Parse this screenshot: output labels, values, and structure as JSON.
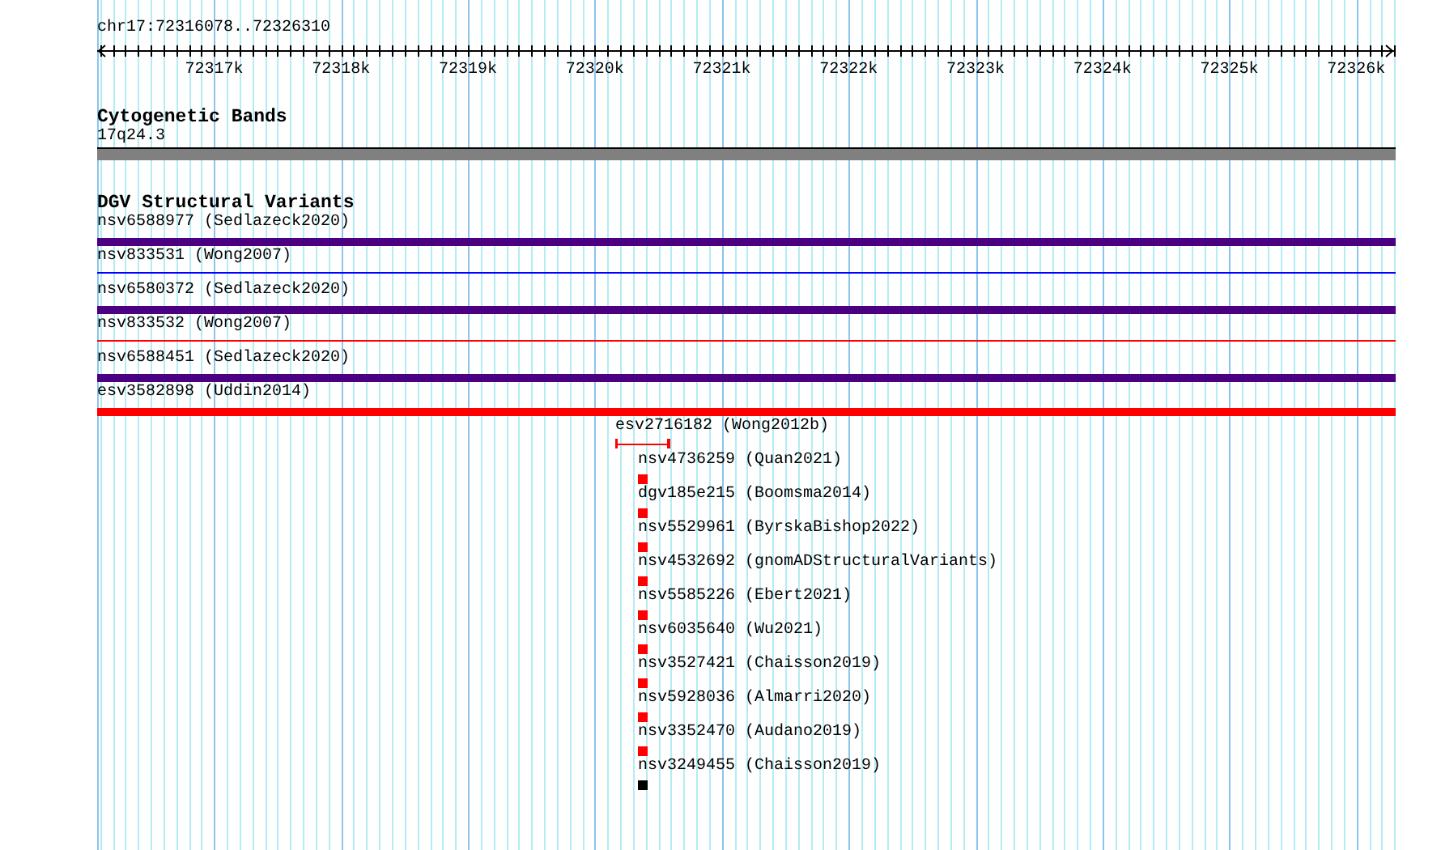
{
  "ruler": {
    "location": "chr17:72316078..72326310",
    "ticks": [
      "72317k",
      "72318k",
      "72319k",
      "72320k",
      "72321k",
      "72322k",
      "72323k",
      "72324k",
      "72325k",
      "72326k"
    ]
  },
  "tracks": [
    {
      "title": "Cytogenetic Bands",
      "features": [
        {
          "label": "17q24.3",
          "kind": "band"
        }
      ]
    },
    {
      "title": "DGV Structural Variants",
      "features": [
        {
          "label": "nsv6588977 (Sedlazeck2020)",
          "kind": "bar",
          "color": "#4b0082"
        },
        {
          "label": "nsv833531 (Wong2007)",
          "kind": "line",
          "color": "#0000ff"
        },
        {
          "label": "nsv6580372 (Sedlazeck2020)",
          "kind": "bar",
          "color": "#4b0082"
        },
        {
          "label": "nsv833532 (Wong2007)",
          "kind": "line",
          "color": "#ff0000"
        },
        {
          "label": "nsv6588451 (Sedlazeck2020)",
          "kind": "bar",
          "color": "#4b0082"
        },
        {
          "label": "esv3582898 (Uddin2014)",
          "kind": "bar",
          "color": "#ff0000"
        },
        {
          "label": "esv2716182 (Wong2012b)",
          "kind": "span",
          "color": "#ff0000"
        },
        {
          "label": "nsv4736259 (Quan2021)",
          "kind": "point",
          "color": "#ff0000"
        },
        {
          "label": "dgv185e215 (Boomsma2014)",
          "kind": "point",
          "color": "#ff0000"
        },
        {
          "label": "nsv5529961 (ByrskaBishop2022)",
          "kind": "point",
          "color": "#ff0000"
        },
        {
          "label": "nsv4532692 (gnomADStructuralVariants)",
          "kind": "point",
          "color": "#ff0000"
        },
        {
          "label": "nsv5585226 (Ebert2021)",
          "kind": "point",
          "color": "#ff0000"
        },
        {
          "label": "nsv6035640 (Wu2021)",
          "kind": "point",
          "color": "#ff0000"
        },
        {
          "label": "nsv3527421 (Chaisson2019)",
          "kind": "point",
          "color": "#ff0000"
        },
        {
          "label": "nsv5928036 (Almarri2020)",
          "kind": "point",
          "color": "#ff0000"
        },
        {
          "label": "nsv3352470 (Audano2019)",
          "kind": "point",
          "color": "#ff0000"
        },
        {
          "label": "nsv3249455 (Chaisson2019)",
          "kind": "point",
          "color": "#000000"
        }
      ]
    }
  ]
}
